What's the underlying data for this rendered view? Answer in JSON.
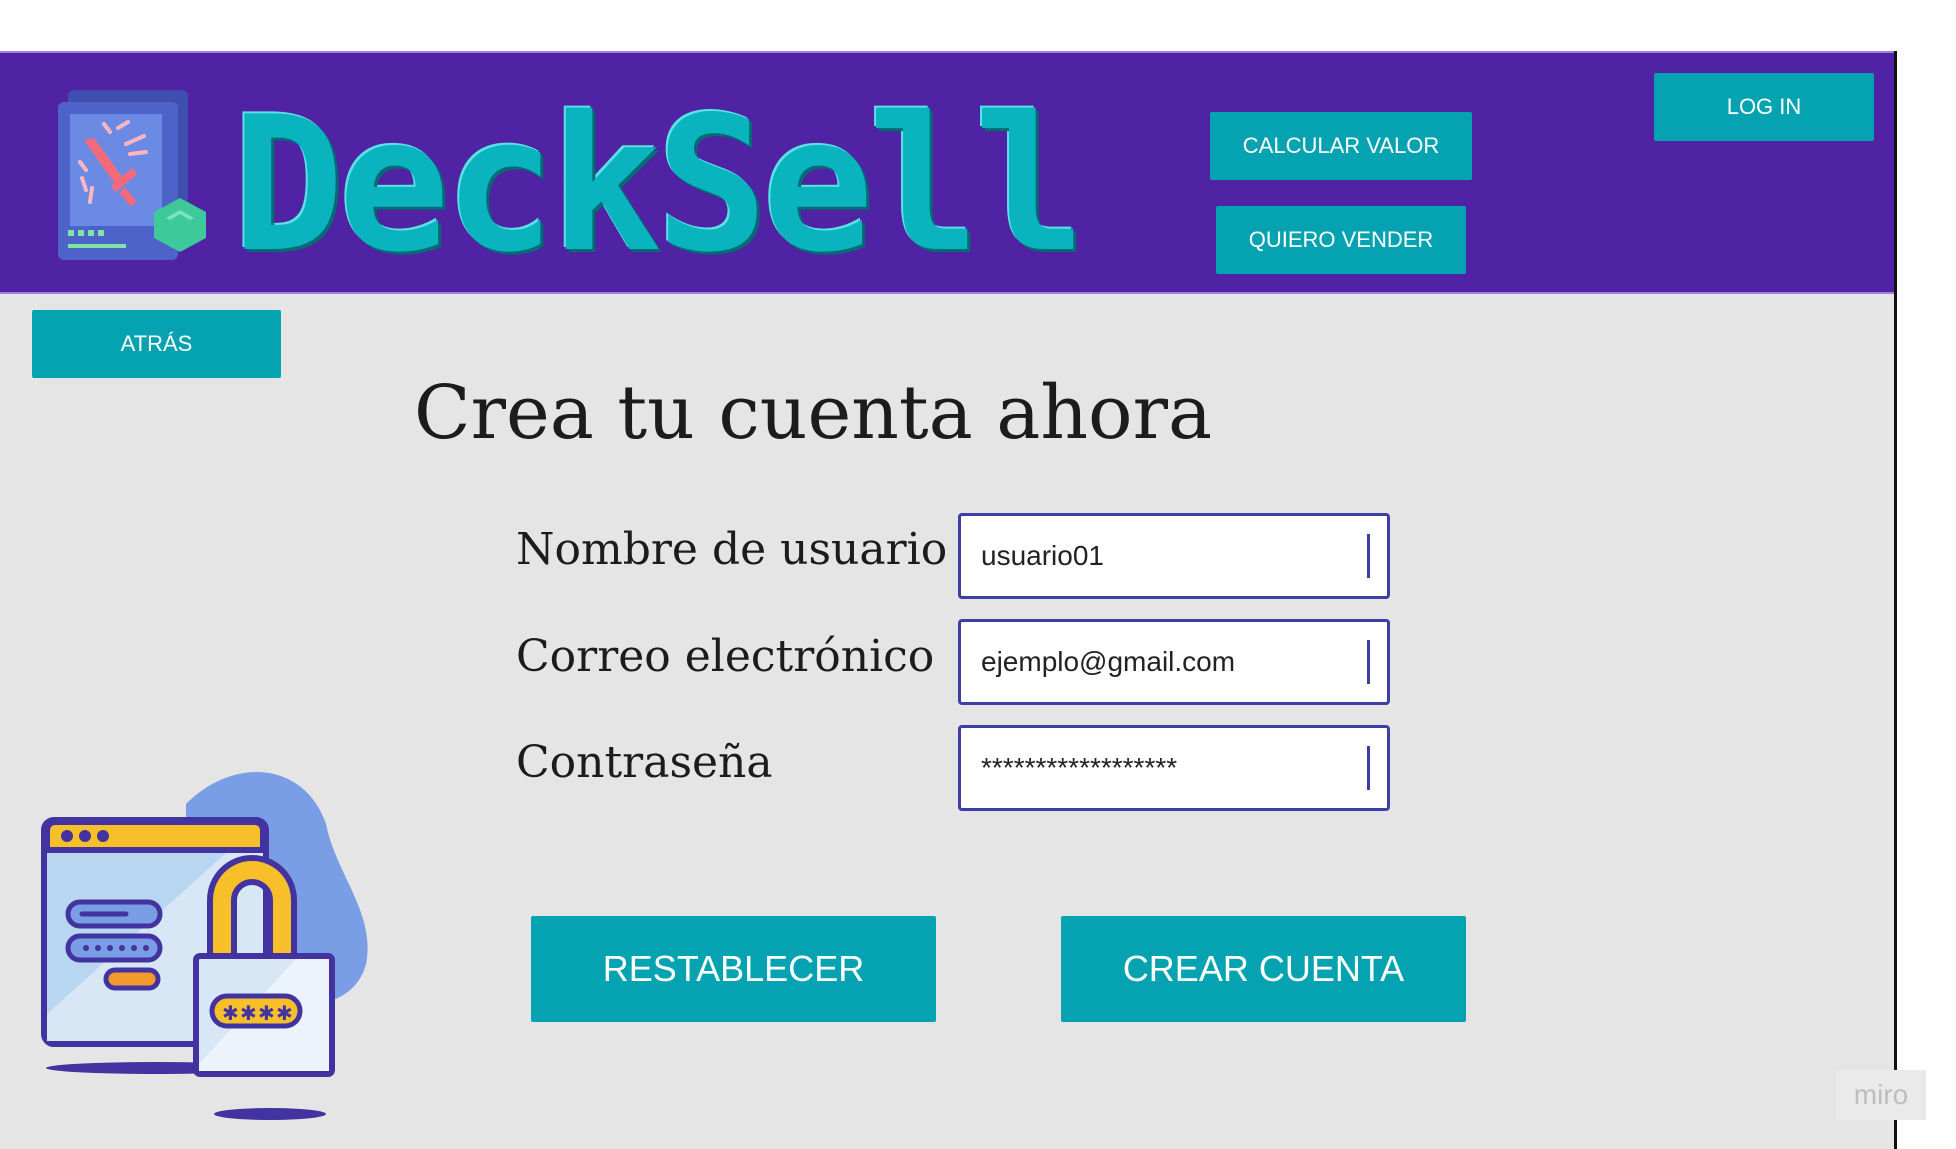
{
  "header": {
    "brand": "DeckSell",
    "calc_label": "CALCULAR VALOR",
    "sell_label": "QUIERO VENDER",
    "login_label": "LOG IN"
  },
  "back_label": "ATRÁS",
  "form": {
    "title": "Crea tu cuenta ahora",
    "username_label": "Nombre de usuario",
    "username_value": "usuario01",
    "email_label": "Correo electrónico",
    "email_value": "ejemplo@gmail.com",
    "password_label": "Contraseña",
    "password_value": "******************",
    "reset_label": "RESTABLECER",
    "create_label": "CREAR CUENTA"
  },
  "watermark": "miro",
  "colors": {
    "header_bg": "#4f23a3",
    "accent": "#05a3b1",
    "input_border": "#3d3fa5"
  }
}
